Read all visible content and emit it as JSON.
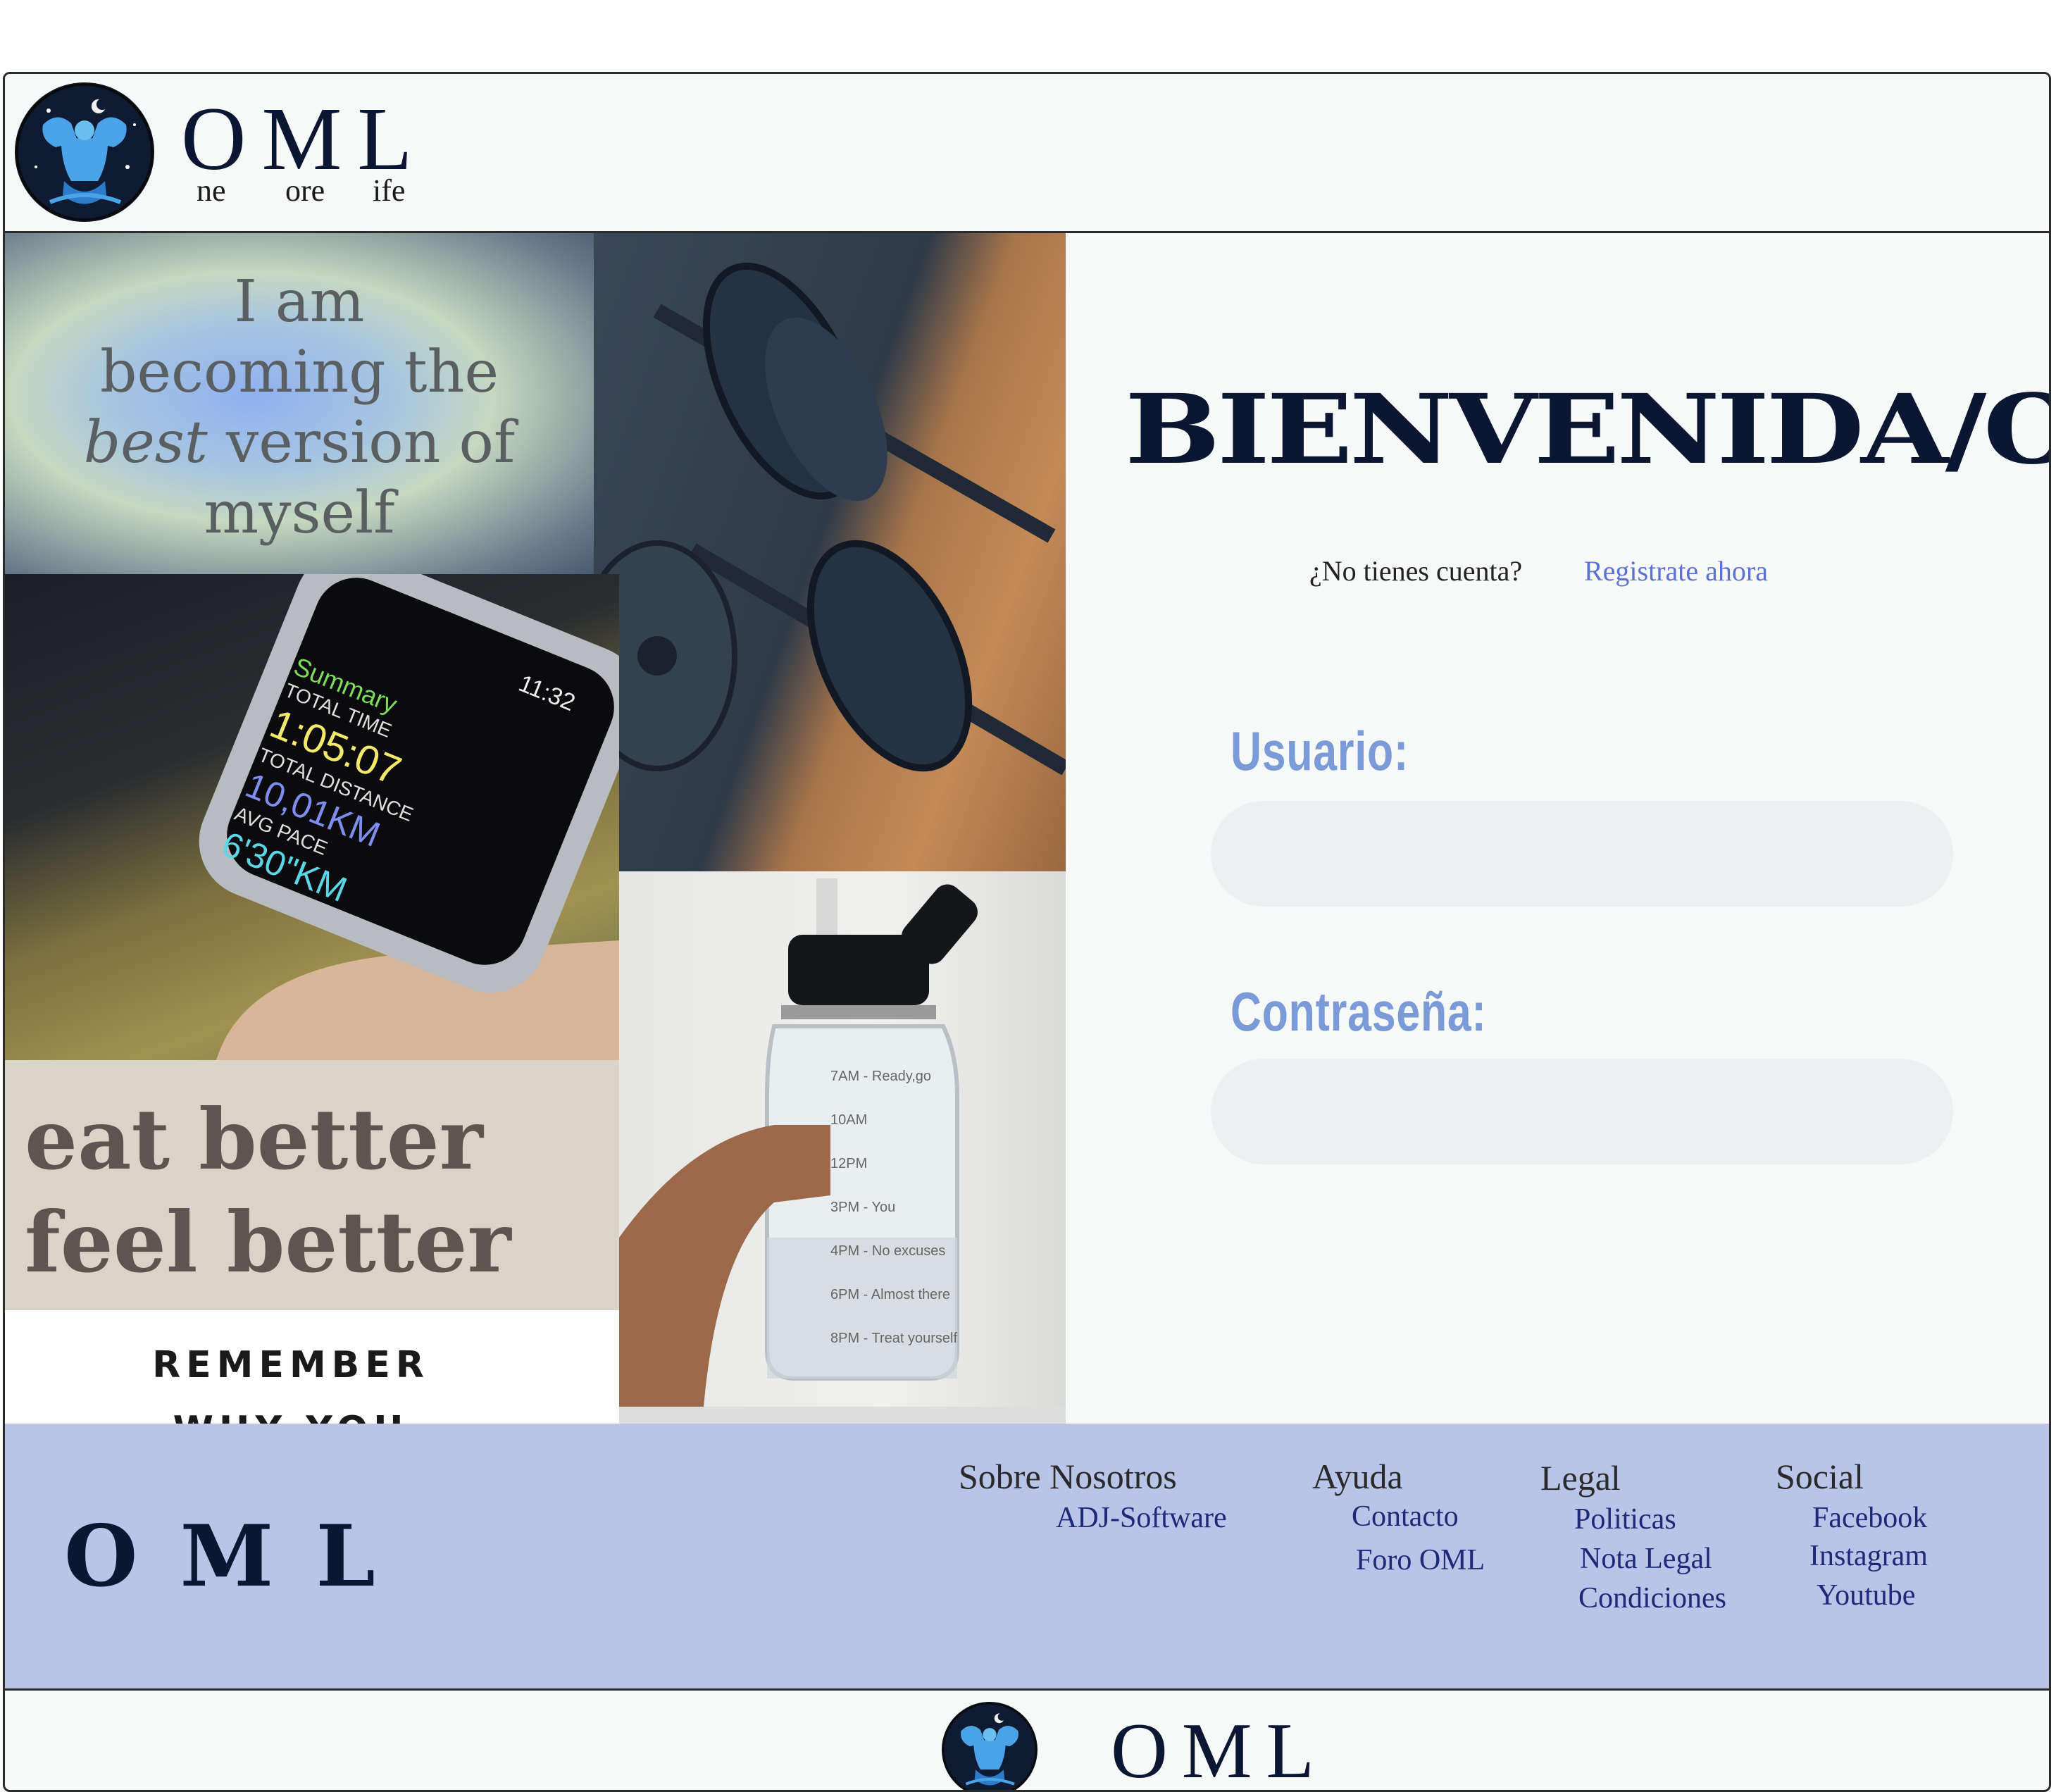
{
  "header": {
    "brand": "OML",
    "tagline": [
      "ne",
      "ore",
      "ife"
    ]
  },
  "collage": {
    "quote_line1": "I am",
    "quote_line2": "becoming the",
    "quote_line3_em": "best",
    "quote_line3_rest": " version of",
    "quote_line4": "myself",
    "watch_summary": "Summary",
    "watch_total_time_label": "TOTAL TIME",
    "watch_total_time": "1:05:07",
    "watch_clock": "11:32",
    "watch_distance_label": "TOTAL DISTANCE",
    "watch_distance": "10,01KM",
    "watch_pace_label": "AVG PACE",
    "watch_pace": "6'30\"KM",
    "eat_line1": "eat better",
    "eat_line2": "feel better",
    "remember": "REMEMBER",
    "remember_cut": "WHY YOU",
    "bottle_marks": [
      "7AM - Ready,go",
      "10AM",
      "12PM",
      "3PM - You",
      "4PM - No excuses",
      "6PM - Almost there",
      "8PM - Treat yourself"
    ]
  },
  "login": {
    "title": "BIENVENIDA/O",
    "no_account": "¿No tienes cuenta?",
    "register": "Registrate ahora",
    "user_label": "Usuario:",
    "user_value": "",
    "password_label": "Contraseña:",
    "password_value": ""
  },
  "footer": {
    "brand": "OML",
    "columns": [
      {
        "heading": "Sobre Nosotros",
        "links": [
          "ADJ-Software"
        ]
      },
      {
        "heading": "Ayuda",
        "links": [
          "Contacto",
          "Foro OML"
        ]
      },
      {
        "heading": "Legal",
        "links": [
          "Politicas",
          "Nota Legal",
          "Condiciones"
        ]
      },
      {
        "heading": "Social",
        "links": [
          "Facebook",
          "Instagram",
          "Youtube"
        ]
      }
    ]
  },
  "bottom_bar": {
    "brand": "OML"
  },
  "colors": {
    "navy": "#0a1632",
    "label_blue": "#7b9ad8",
    "link_blue": "#5b72d4",
    "footer_bg": "#b8c5e8",
    "footer_link": "#1d2a78"
  }
}
